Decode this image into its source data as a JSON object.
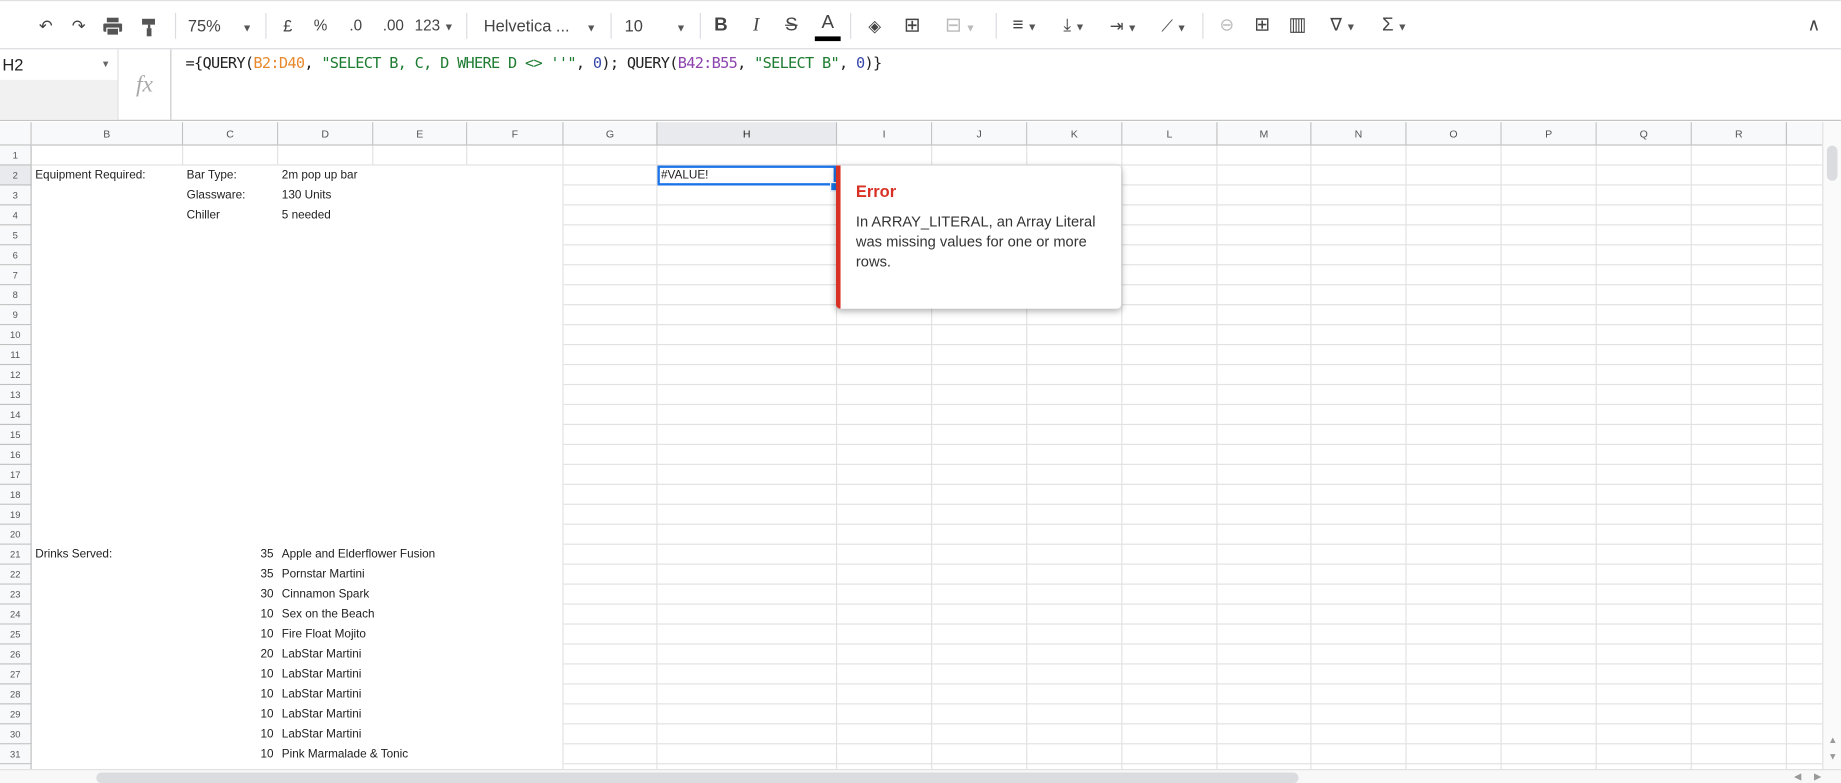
{
  "toolbar": {
    "items": [
      {
        "name": "undo-icon",
        "glyph": "↶"
      },
      {
        "name": "redo-icon",
        "glyph": "↷"
      },
      {
        "name": "print-icon",
        "glyph": "🖶"
      },
      {
        "name": "paint-format-icon",
        "glyph": "🖌"
      }
    ],
    "zoom": "75%",
    "currency": "£",
    "percent": "%",
    "decrease_decimals": ".0",
    "increase_decimals": ".00",
    "more_formats": "123",
    "font": "Helvetica ...",
    "font_size": "10",
    "bold": "B",
    "italic": "I",
    "strikethrough": "S",
    "text_color": "A",
    "text_color_value": "#000000"
  },
  "formula_bar": {
    "cell_ref": "H2",
    "fx_label": "fx",
    "segments": [
      {
        "text": "={QUERY(",
        "color": "#222222"
      },
      {
        "text": "B2:D40",
        "color": "#e8892d"
      },
      {
        "text": ", ",
        "color": "#222222"
      },
      {
        "text": "\"SELECT B, C, D WHERE D <> ''\"",
        "color": "#1e7d32"
      },
      {
        "text": ", ",
        "color": "#222222"
      },
      {
        "text": "0",
        "color": "#3949ab"
      },
      {
        "text": "); QUERY(",
        "color": "#222222"
      },
      {
        "text": "B42:B55",
        "color": "#8e44ad"
      },
      {
        "text": ", ",
        "color": "#222222"
      },
      {
        "text": "\"SELECT B\"",
        "color": "#1e7d32"
      },
      {
        "text": ", ",
        "color": "#222222"
      },
      {
        "text": "0",
        "color": "#3949ab"
      },
      {
        "text": ")}",
        "color": "#222222"
      }
    ]
  },
  "sheet": {
    "columns": [
      "B",
      "C",
      "D",
      "E",
      "F",
      "G",
      "H",
      "I",
      "J",
      "K",
      "L",
      "M",
      "N",
      "O",
      "P",
      "Q",
      "R"
    ],
    "selected_column": "H",
    "selected_row": 2,
    "rows": [
      "1",
      "2",
      "3",
      "4",
      "5",
      "6",
      "7",
      "8",
      "9",
      "10",
      "11",
      "12",
      "13",
      "14",
      "15",
      "16",
      "17",
      "18",
      "19",
      "20",
      "21",
      "22",
      "23",
      "24",
      "25",
      "26",
      "27",
      "28",
      "29",
      "30",
      "31"
    ],
    "cells": {
      "B2": "Equipment Required:",
      "C2": "Bar Type:",
      "D2": "2m pop up bar",
      "C3": "Glassware:",
      "D3": "130 Units",
      "C4": "Chiller",
      "D4": "5 needed",
      "H2": "#VALUE!",
      "B21": "Drinks Served:",
      "C21": "35",
      "D21": "Apple and Elderflower Fusion",
      "C22": "35",
      "D22": "Pornstar Martini",
      "C23": "30",
      "D23": "Cinnamon Spark",
      "C24": "10",
      "D24": "Sex on the Beach",
      "C25": "10",
      "D25": "Fire Float Mojito",
      "C26": "20",
      "D26": "LabStar Martini",
      "C27": "10",
      "D27": "LabStar Martini",
      "C28": "10",
      "D28": "LabStar Martini",
      "C29": "10",
      "D29": "LabStar Martini",
      "C30": "10",
      "D30": "LabStar Martini",
      "C31": "10",
      "D31": "Pink Marmalade & Tonic"
    }
  },
  "error_popup": {
    "title": "Error",
    "message": "In ARRAY_LITERAL, an Array Literal was missing values for one or more rows.",
    "accent_color": "#d93025"
  }
}
